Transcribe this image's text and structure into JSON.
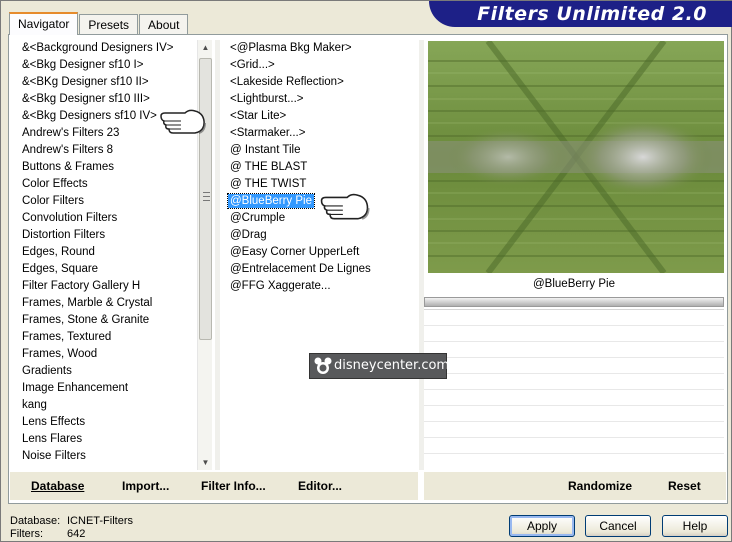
{
  "tabs": [
    {
      "label": "Navigator",
      "active": true
    },
    {
      "label": "Presets",
      "active": false
    },
    {
      "label": "About",
      "active": false
    }
  ],
  "banner": {
    "title": "Filters Unlimited 2.0"
  },
  "categories": [
    "&<Background Designers IV>",
    "&<Bkg Designer sf10 I>",
    "&<BKg Designer sf10 II>",
    "&<Bkg Designer sf10 III>",
    "&<Bkg Designers sf10 IV>",
    "Andrew's Filters 23",
    "Andrew's Filters 8",
    "Buttons & Frames",
    "Color Effects",
    "Color Filters",
    "Convolution Filters",
    "Distortion Filters",
    "Edges, Round",
    "Edges, Square",
    "Filter Factory Gallery H",
    "Frames, Marble & Crystal",
    "Frames, Stone & Granite",
    "Frames, Textured",
    "Frames, Wood",
    "Gradients",
    "Image Enhancement",
    "kang",
    "Lens Effects",
    "Lens Flares",
    "Noise Filters"
  ],
  "filters": [
    "<@Plasma Bkg Maker>",
    "<Grid...>",
    "<Lakeside Reflection>",
    "<Lightburst...>",
    "<Star Lite>",
    "<Starmaker...>",
    "@ Instant Tile",
    "@ THE BLAST",
    "@ THE TWIST",
    "@BlueBerry Pie",
    "@Crumple",
    "@Drag",
    "@Easy Corner UpperLeft",
    "@Entrelacement De Lignes",
    "@FFG Xaggerate..."
  ],
  "selected_filter_index": 9,
  "preview": {
    "label": "@BlueBerry Pie"
  },
  "left_actions": {
    "database": "Database",
    "import": "Import...",
    "filter_info": "Filter Info...",
    "editor": "Editor..."
  },
  "right_actions": {
    "randomize": "Randomize",
    "reset": "Reset"
  },
  "footer": {
    "database_label": "Database:",
    "database_value": "ICNET-Filters",
    "filters_label": "Filters:",
    "filters_value": "642"
  },
  "buttons": {
    "apply": "Apply",
    "cancel": "Cancel",
    "help": "Help"
  },
  "watermark": {
    "text": "disneycenter.com"
  },
  "colors": {
    "banner": "#1d2087",
    "selection": "#3399ff",
    "tab_accent": "#e68b2c"
  }
}
